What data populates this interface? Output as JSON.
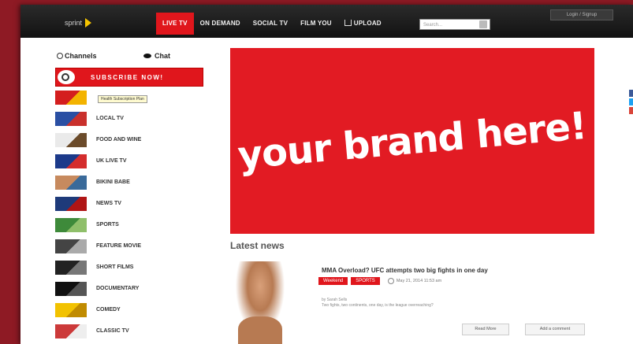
{
  "header": {
    "logo_text": "sprint",
    "nav": [
      "LIVE TV",
      "ON DEMAND",
      "SOCIAL TV",
      "FILM YOU"
    ],
    "upload_label": "UPLOAD",
    "search_placeholder": "Search...",
    "login_label": "Login / Signup"
  },
  "sidebar": {
    "tabs": {
      "channels": "Channels",
      "chat": "Chat"
    },
    "subscribe_label": "SUBSCRIBE NOW!",
    "tooltip": "Health Subscription Plan",
    "channels": [
      {
        "label": "",
        "colors": [
          "#d41e1e",
          "#f3b300"
        ]
      },
      {
        "label": "LOCAL TV",
        "colors": [
          "#2a4fa3",
          "#c9302c"
        ]
      },
      {
        "label": "FOOD AND WINE",
        "colors": [
          "#eaeaea",
          "#6b4b2a"
        ]
      },
      {
        "label": "UK LIVE TV",
        "colors": [
          "#1c3a8a",
          "#d42d2d"
        ]
      },
      {
        "label": "BIKINI BABE",
        "colors": [
          "#c78a5e",
          "#3a6a9a"
        ]
      },
      {
        "label": "NEWS TV",
        "colors": [
          "#1e3a7a",
          "#b01515"
        ]
      },
      {
        "label": "SPORTS",
        "colors": [
          "#3e8a3a",
          "#8fbf6a"
        ]
      },
      {
        "label": "FEATURE MOVIE",
        "colors": [
          "#444444",
          "#aaaaaa"
        ]
      },
      {
        "label": "SHORT FILMS",
        "colors": [
          "#222222",
          "#777777"
        ]
      },
      {
        "label": "DOCUMENTARY",
        "colors": [
          "#111111",
          "#555555"
        ]
      },
      {
        "label": "COMEDY",
        "colors": [
          "#f2c200",
          "#c08b00"
        ]
      },
      {
        "label": "CLASSIC TV",
        "colors": [
          "#cc3a3a",
          "#eeeeee"
        ]
      }
    ]
  },
  "banner": {
    "text": "your brand here!"
  },
  "news": {
    "heading": "Latest news",
    "title": "MMA Overload? UFC attempts two big fights in one day",
    "tags": [
      "Weekend",
      "SPORTS"
    ],
    "date": "May 21, 2014 11:53 am",
    "meta": [
      "by Sarah Sells",
      "Two fights, two continents, one day, is the league overreaching?"
    ],
    "read_more": "Read More",
    "add_comment": "Add a comment"
  },
  "colors": {
    "brand_red": "#e0161c",
    "page_bg": "#8e1a24"
  }
}
